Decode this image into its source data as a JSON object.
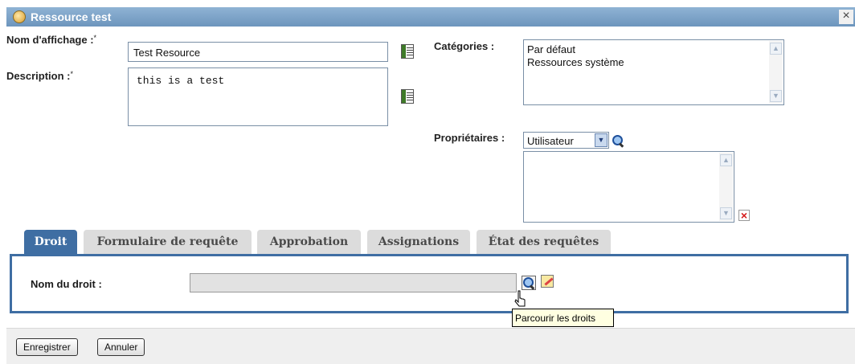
{
  "window": {
    "title": "Ressource test",
    "close_glyph": "×"
  },
  "form": {
    "display_name_label": "Nom d'affichage :",
    "display_name_value": "Test Resource",
    "description_label": "Description :",
    "description_value": "this is a test",
    "required_marker": "*",
    "categories_label": "Catégories :",
    "categories": [
      "Par défaut",
      "Ressources système"
    ],
    "owners_label": "Propriétaires :",
    "owner_type_selected": "Utilisateur",
    "owners": []
  },
  "tabs": [
    {
      "label": "Droit",
      "active": true
    },
    {
      "label": "Formulaire de requête",
      "active": false
    },
    {
      "label": "Approbation",
      "active": false
    },
    {
      "label": "Assignations",
      "active": false
    },
    {
      "label": "État des requêtes",
      "active": false
    }
  ],
  "entitlement": {
    "label": "Nom du droit :",
    "value": ""
  },
  "tooltip": "Parcourir les droits",
  "footer": {
    "save_label": "Enregistrer",
    "cancel_label": "Annuler"
  },
  "colors": {
    "title_bar": "#7aa0c6",
    "active_tab": "#3f6ea3",
    "inactive_tab": "#dcdcdc",
    "delete_red": "#d41818"
  },
  "icons": [
    "resource-icon",
    "close-icon",
    "edit-list-icon",
    "search-icon",
    "delete-icon",
    "clear-icon",
    "mouse-pointer-icon"
  ]
}
